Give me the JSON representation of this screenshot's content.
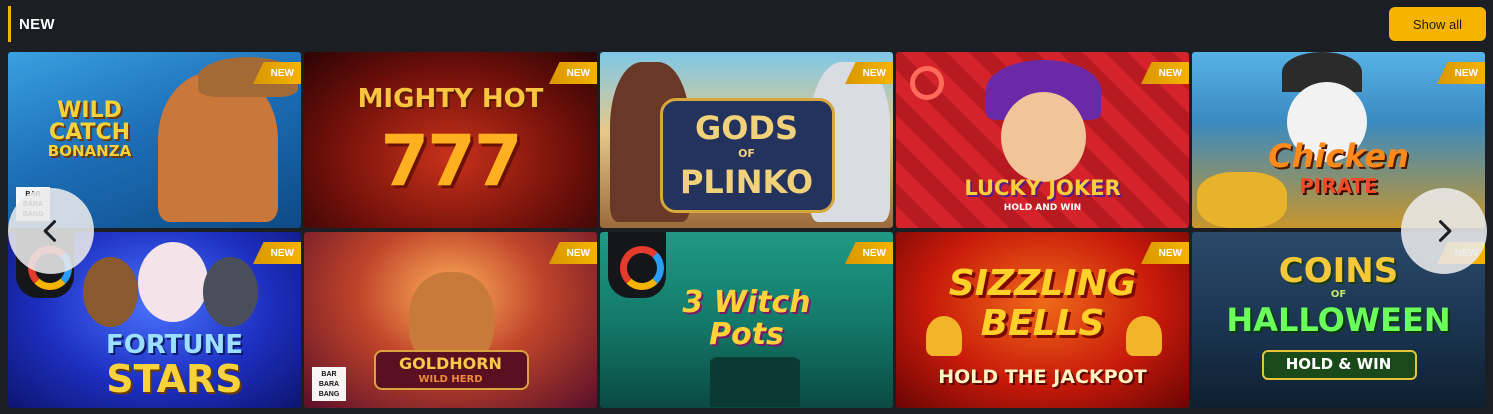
{
  "section": {
    "title": "NEW",
    "show_all_label": "Show all"
  },
  "badge_label": "NEW",
  "provider_barbarabang": [
    "BAR",
    "BARA",
    "BANG"
  ],
  "icons": {
    "prev": "chevron-left-icon",
    "next": "chevron-right-icon"
  },
  "colors": {
    "accent": "#f5b400",
    "background": "#1b1f23",
    "badge_text": "#ffffff"
  },
  "games": [
    {
      "title": "WILD CATCH BONANZA",
      "line1": "WILD",
      "line2": "CATCH",
      "line3": "BONANZA"
    },
    {
      "title": "MIGHTY HOT 777",
      "line1": "MIGHTY HOT",
      "line2": "777"
    },
    {
      "title": "GODS OF PLINKO",
      "line1": "GODS",
      "line2": "OF",
      "line3": "PLINKO"
    },
    {
      "title": "LUCKY JOKER HOLD AND WIN",
      "line1": "LUCKY JOKER",
      "line2": "HOLD AND WIN"
    },
    {
      "title": "Chicken PIRATE",
      "line1": "Chicken",
      "line2": "PIRATE"
    },
    {
      "title": "FORTUNE STARS",
      "line1": "FORTUNE",
      "line2": "STARS"
    },
    {
      "title": "GOLDHORN WILD HERD",
      "line1": "GOLDHORN",
      "line2": "WILD HERD"
    },
    {
      "title": "3 Witch Pots",
      "line1": "3 Witch",
      "line2": "Pots"
    },
    {
      "title": "SIZZLING BELLS HOLD THE JACKPOT",
      "line1": "SIZZLING",
      "line2": "BELLS",
      "line3": "HOLD THE JACKPOT"
    },
    {
      "title": "COINS OF HALLOWEEN HOLD & WIN",
      "line1": "COINS",
      "line2": "OF",
      "line3": "HALLOWEEN",
      "line4": "HOLD & WIN"
    }
  ]
}
